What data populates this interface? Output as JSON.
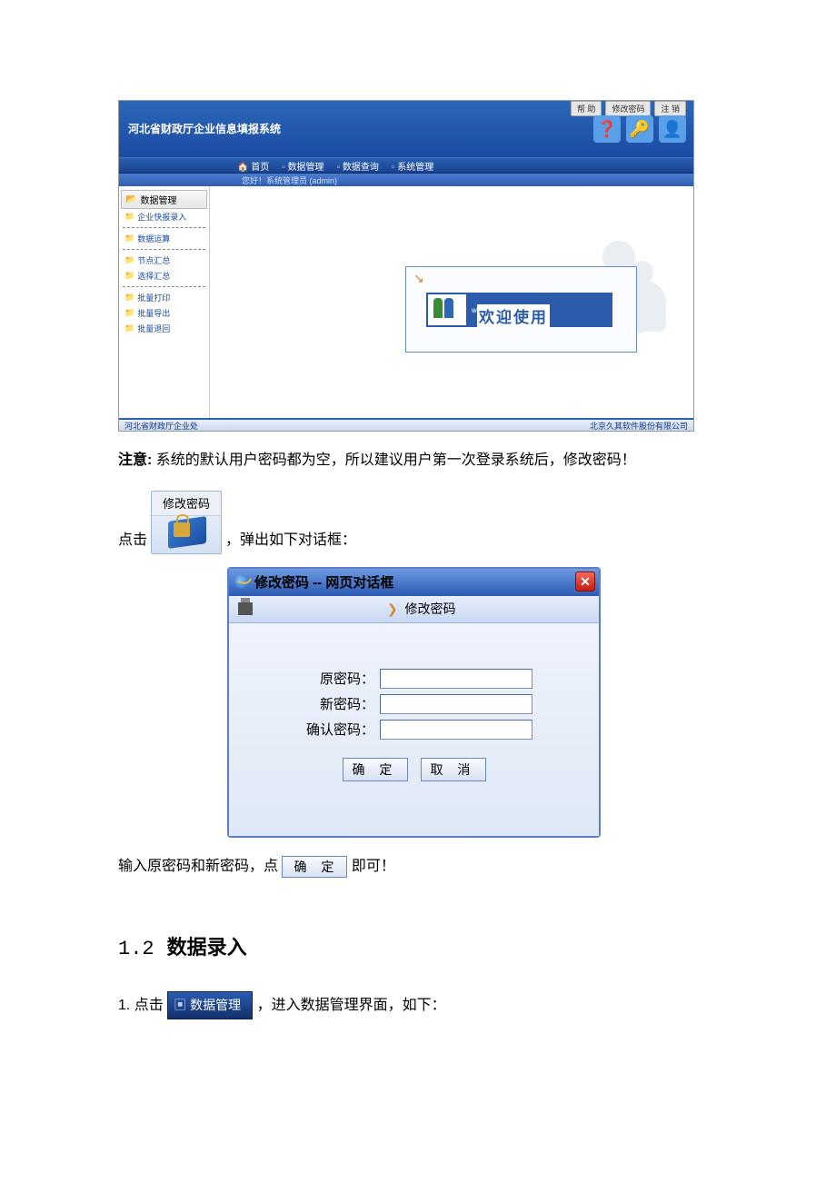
{
  "app": {
    "title": "河北省财政厅企业信息填报系统",
    "top_buttons": {
      "help": "帮  助",
      "pw": "修改密码",
      "logout": "注  销"
    },
    "menu": {
      "home": "首页",
      "data_mgmt": "数据管理",
      "data_query": "数据查询",
      "sys_mgmt": "系统管理"
    },
    "welcome_bar": "您好！系统管理员 (admin)",
    "sidebar": {
      "header": "数据管理",
      "items": [
        "企业快报录入",
        "数据运算",
        "节点汇总",
        "选择汇总",
        "批量打印",
        "批量导出",
        "批量退回"
      ]
    },
    "welcome_box": {
      "small": "welcome",
      "big": "欢迎使用"
    },
    "footer_left": "河北省财政厅企业处",
    "footer_right": "北京久其软件股份有限公司"
  },
  "doc": {
    "note_label": "注意:",
    "note_text": "系统的默认用户密码都为空，所以建议用户第一次登录系统后，修改密码！",
    "click_prefix": "点击",
    "click_suffix": "，弹出如下对话框：",
    "small_pw_btn": "修改密码",
    "after_input": "输入原密码和新密码，点",
    "after_input2": "即可！",
    "sec_num": "1.2",
    "sec_title": "数据录入",
    "step1_a": "1.  点击",
    "step1_b": "，进入数据管理界面，如下：",
    "dm_tab": "数据管理"
  },
  "dialog": {
    "title": "修改密码 -- 网页对话框",
    "sub": "修改密码",
    "old": "原密码：",
    "new": "新密码：",
    "confirm": "确认密码：",
    "ok": "确 定",
    "cancel": "取 消"
  }
}
